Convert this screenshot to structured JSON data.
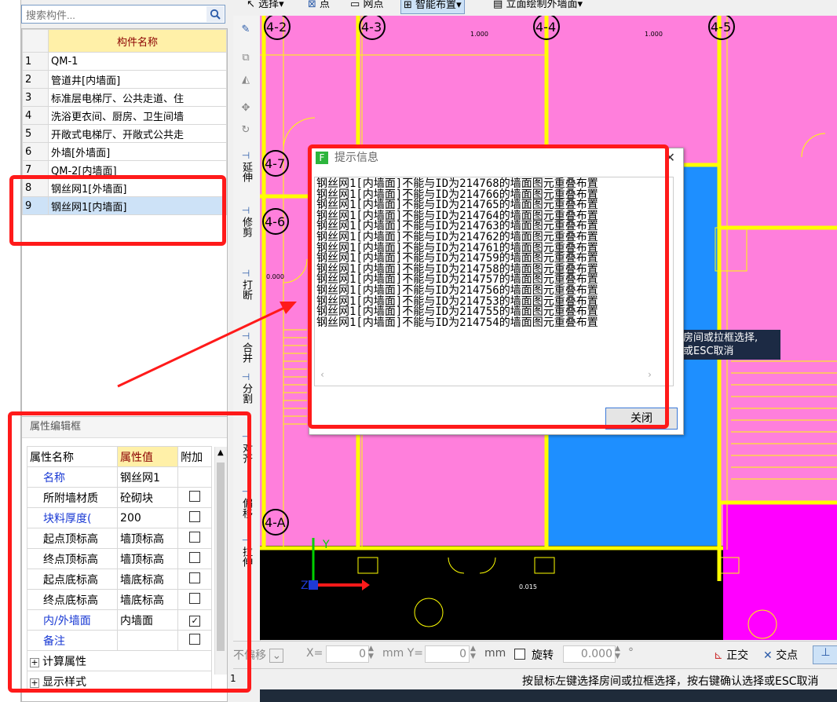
{
  "search": {
    "placeholder": "搜索构件..."
  },
  "component_list": {
    "header": "构件名称",
    "items": [
      {
        "num": "1",
        "name": "QM-1"
      },
      {
        "num": "2",
        "name": "管道井[内墙面]"
      },
      {
        "num": "3",
        "name": "标准层电梯厅、公共走道、住"
      },
      {
        "num": "4",
        "name": "洗浴更衣间、厨房、卫生间墙"
      },
      {
        "num": "5",
        "name": "开敞式电梯厅、开敞式公共走"
      },
      {
        "num": "6",
        "name": "外墙[外墙面]"
      },
      {
        "num": "7",
        "name": "QM-2[内墙面]"
      },
      {
        "num": "8",
        "name": "钢丝网1[外墙面]"
      },
      {
        "num": "9",
        "name": "钢丝网1[内墙面]"
      }
    ]
  },
  "property_panel": {
    "title": "属性编辑框",
    "col_name": "属性名称",
    "col_value": "属性值",
    "col_extra": "附加",
    "rows": [
      {
        "name": "名称",
        "value": "钢丝网1",
        "checked": ""
      },
      {
        "name": "所附墙材质",
        "value": "砼砌块",
        "checked": "box"
      },
      {
        "name": "块料厚度(",
        "value": "200",
        "checked": "box"
      },
      {
        "name": "起点顶标高",
        "value": "墙顶标高",
        "checked": "box"
      },
      {
        "name": "终点顶标高",
        "value": "墙顶标高",
        "checked": "box"
      },
      {
        "name": "起点底标高",
        "value": "墙底标高",
        "checked": "box"
      },
      {
        "name": "终点底标高",
        "value": "墙底标高",
        "checked": "box"
      },
      {
        "name": "内/外墙面",
        "value": "内墙面",
        "checked": "check"
      },
      {
        "name": "备注",
        "value": "",
        "checked": "box"
      }
    ],
    "groups": [
      "计算属性",
      "显示样式"
    ]
  },
  "toolbar": {
    "select": "选择",
    "point": "点",
    "grid_point": "网点",
    "smart_layout": "智能布置",
    "elevation": "立面绘制外墙面"
  },
  "vertical_tools": [
    "延伸",
    "修剪",
    "打断",
    "合并",
    "分割",
    "对齐",
    "偏移",
    "拉伸"
  ],
  "grid_labels": [
    "4-2",
    "4-3",
    "4-4",
    "4-5",
    "4-7",
    "4-6",
    "4-A"
  ],
  "dialog": {
    "title": "提示信息",
    "messages": [
      "钢丝网1[内墙面]不能与ID为214768的墙面图元重叠布置",
      "钢丝网1[内墙面]不能与ID为214766的墙面图元重叠布置",
      "钢丝网1[内墙面]不能与ID为214765的墙面图元重叠布置",
      "钢丝网1[内墙面]不能与ID为214764的墙面图元重叠布置",
      "钢丝网1[内墙面]不能与ID为214763的墙面图元重叠布置",
      "钢丝网1[内墙面]不能与ID为214762的墙面图元重叠布置",
      "钢丝网1[内墙面]不能与ID为214761的墙面图元重叠布置",
      "钢丝网1[内墙面]不能与ID为214759的墙面图元重叠布置",
      "钢丝网1[内墙面]不能与ID为214758的墙面图元重叠布置",
      "钢丝网1[内墙面]不能与ID为214757的墙面图元重叠布置",
      "钢丝网1[内墙面]不能与ID为214756的墙面图元重叠布置",
      "钢丝网1[内墙面]不能与ID为214753的墙面图元重叠布置",
      "钢丝网1[内墙面]不能与ID为214755的墙面图元重叠布置",
      "钢丝网1[内墙面]不能与ID为214754的墙面图元重叠布置"
    ],
    "close_label": "关闭"
  },
  "tooltip": {
    "line1": "房间或拉框选择,",
    "line2": "或ESC取消"
  },
  "bottom_bar": {
    "offset": "不偏移",
    "x_label": "X=",
    "x_value": "0",
    "y_label": "mm Y=",
    "y_value": "0",
    "unit": "mm",
    "rotate": "旋转",
    "angle": "0.000",
    "degree": "°",
    "orthogonal": "正交",
    "intersection": "交点"
  },
  "status": {
    "text": "按鼠标左键选择房间或拉框选择，按右键确认选择或ESC取消",
    "page_num": "1"
  },
  "canvas_labels": [
    "1.000",
    "1.000",
    "0.015",
    "0.000"
  ],
  "colors": {
    "magenta": "#ff7fdc",
    "blue": "#1e8fff",
    "yellow": "#ffff00",
    "red": "#ff1a1a"
  }
}
